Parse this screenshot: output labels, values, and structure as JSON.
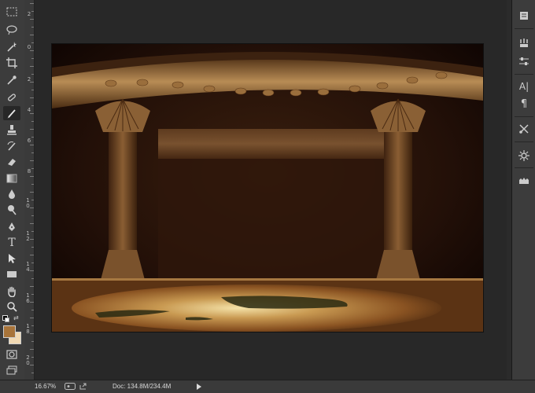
{
  "toolbar": {
    "tools": [
      {
        "name": "marquee-tool",
        "icon": "rect-marquee-icon"
      },
      {
        "name": "lasso-tool",
        "icon": "lasso-icon"
      },
      {
        "name": "magic-wand-tool",
        "icon": "magic-wand-icon"
      },
      {
        "name": "crop-tool",
        "icon": "crop-icon"
      },
      {
        "name": "eyedropper-tool",
        "icon": "eyedropper-icon"
      },
      {
        "name": "healing-brush-tool",
        "icon": "healing-brush-icon"
      },
      {
        "name": "brush-tool",
        "icon": "brush-icon",
        "active": true
      },
      {
        "name": "clone-stamp-tool",
        "icon": "stamp-icon"
      },
      {
        "name": "history-brush-tool",
        "icon": "history-brush-icon"
      },
      {
        "name": "eraser-tool",
        "icon": "eraser-icon"
      },
      {
        "name": "gradient-tool",
        "icon": "gradient-icon"
      },
      {
        "name": "blur-tool",
        "icon": "drop-icon"
      },
      {
        "name": "dodge-tool",
        "icon": "dodge-icon"
      },
      {
        "name": "pen-tool",
        "icon": "pen-icon"
      },
      {
        "name": "type-tool",
        "icon": "type-icon",
        "glyph": "T"
      },
      {
        "name": "path-selection-tool",
        "icon": "arrow-icon"
      },
      {
        "name": "rectangle-tool",
        "icon": "rectangle-icon"
      },
      {
        "name": "hand-tool",
        "icon": "hand-icon"
      },
      {
        "name": "zoom-tool",
        "icon": "zoom-icon"
      }
    ],
    "foreground_color": "#a8743a",
    "background_color": "#f1d9b3"
  },
  "ruler": {
    "labels": [
      "2",
      "0",
      "2",
      "4",
      "6",
      "8",
      "1 0",
      "1 2",
      "1 4",
      "1 6",
      "1 8",
      "2 0"
    ]
  },
  "right_panel": {
    "buttons": [
      {
        "name": "panel-layers-button",
        "icon": "layers-icon"
      },
      {
        "name": "panel-brush-presets-button",
        "icon": "brush-presets-icon"
      },
      {
        "name": "panel-adjust-button",
        "icon": "sliders-icon"
      },
      {
        "name": "panel-character-button",
        "icon": "character-icon",
        "glyph": "A|"
      },
      {
        "name": "panel-paragraph-button",
        "icon": "paragraph-icon",
        "glyph": "¶"
      },
      {
        "name": "panel-tools-button",
        "icon": "tool-presets-icon"
      },
      {
        "name": "panel-color-button",
        "icon": "color-wheel-icon"
      },
      {
        "name": "panel-swatches-button",
        "icon": "swatches-icon"
      }
    ]
  },
  "status": {
    "zoom": "16.67%",
    "doc_info": "Doc: 134.8M/234.4M"
  },
  "colors": {
    "canvas_bg": "#282828",
    "panel_bg": "#3c3c3c"
  }
}
